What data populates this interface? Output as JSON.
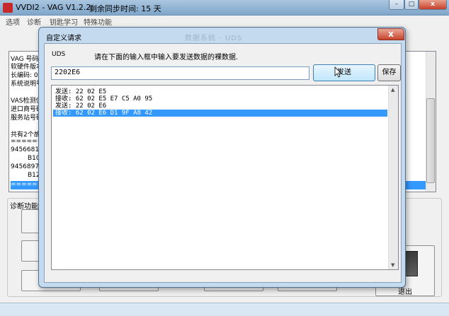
{
  "main_window": {
    "title": "VVDI2 - VAG V1.2.2",
    "countdown": "剩余同步时间: 15 天",
    "menu": [
      "选项",
      "诊断",
      "钥匙学习",
      "特殊功能"
    ],
    "window_controls": {
      "minimize": "–",
      "maximize": "□",
      "close": "x"
    },
    "info_lines": [
      "VAG 号码",
      "软硬件版本",
      "长编码: 00",
      "系统说明号",
      "",
      "VAS检测仪",
      "进口商号码",
      "服务站号码",
      "",
      "共有2个故",
      "==========",
      "9456681",
      "B104",
      "9456897",
      "B12",
      "=========="
    ],
    "diag_group_label": "诊断功能",
    "exit_label": "退出"
  },
  "dialog": {
    "title": "自定义请求",
    "watermark": "数据系统 - UDS",
    "close_label": "x",
    "uds_label": "UDS",
    "hint": "请在下面的输入框中输入要发送数据的裸数据.",
    "input_value": "2202E6",
    "send_label": "发送",
    "save_label": "保存",
    "log": [
      "发送: 22 02 E5",
      "接收: 62 02 E5 E7 C5 A0 95",
      "发送: 22 02 E6",
      "接收: 62 02 E6 D1 9F A8 42"
    ],
    "selected_log_index": 3
  },
  "colors": {
    "selection": "#3399ff",
    "title_bar": "#7fa6c9",
    "dialog_frame": "#c4daee"
  }
}
